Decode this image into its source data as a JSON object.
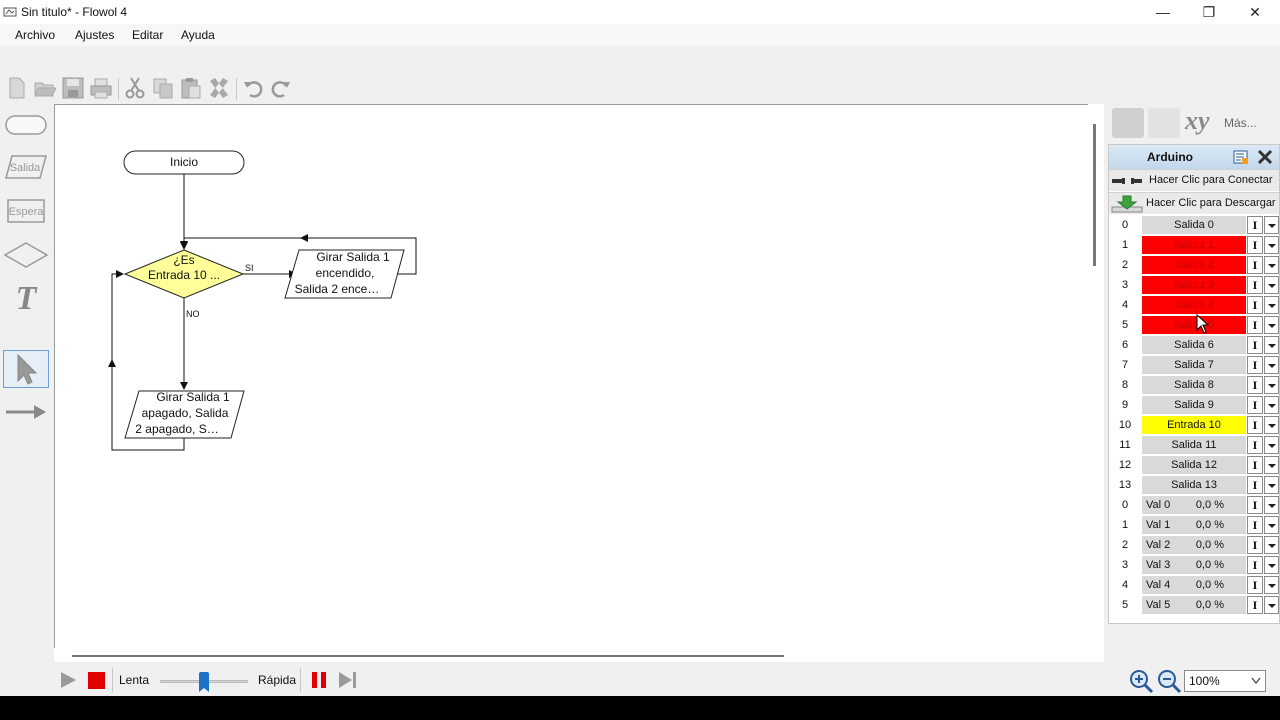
{
  "window": {
    "title": "Sin titulo* - Flowol 4",
    "minimize_glyph": "—",
    "maximize_glyph": "❐",
    "close_glyph": "✕"
  },
  "menu": {
    "items": [
      "Archivo",
      "Ajustes",
      "Editar",
      "Ayuda"
    ]
  },
  "toolbar": {
    "icons": [
      "new-icon",
      "open-icon",
      "save-icon",
      "print-icon",
      "cut-icon",
      "copy-icon",
      "paste-icon",
      "delete-icon",
      "undo-icon",
      "redo-icon"
    ]
  },
  "palette": {
    "items": [
      {
        "name": "start-stop-shape",
        "label": ""
      },
      {
        "name": "output-shape",
        "label": "Salida"
      },
      {
        "name": "wait-shape",
        "label": "Espera"
      },
      {
        "name": "decision-shape",
        "label": ""
      },
      {
        "name": "text-tool",
        "label": "T"
      },
      {
        "name": "pointer-tool",
        "label": ""
      },
      {
        "name": "arrow-tool",
        "label": ""
      }
    ]
  },
  "flowchart": {
    "start": "Inicio",
    "decision_line1": "¿Es",
    "decision_line2": "Entrada 10 ...",
    "yes_label": "SI",
    "no_label": "NO",
    "output_yes": [
      "Girar Salida 1",
      "encendido,",
      "Salida 2 ence…"
    ],
    "output_no": [
      "Girar Salida 1",
      "apagado, Salida",
      "2 apagado, S…"
    ]
  },
  "right_tools": {
    "more_label": "Más...",
    "xy_label": "xy"
  },
  "arduino": {
    "title": "Arduino",
    "connect_label": "Hacer Clic para Conectar",
    "download_label": "Hacer Clic para Descargar",
    "io_button": "I",
    "digital_rows": [
      {
        "num": "0",
        "label": "Salida 0",
        "state": "off"
      },
      {
        "num": "1",
        "label": "Salida 1",
        "state": "on"
      },
      {
        "num": "2",
        "label": "Salida 2",
        "state": "on"
      },
      {
        "num": "3",
        "label": "Salida 3",
        "state": "on"
      },
      {
        "num": "4",
        "label": "Salida 4",
        "state": "on"
      },
      {
        "num": "5",
        "label": "Salida 5",
        "state": "on"
      },
      {
        "num": "6",
        "label": "Salida 6",
        "state": "off"
      },
      {
        "num": "7",
        "label": "Salida 7",
        "state": "off"
      },
      {
        "num": "8",
        "label": "Salida 8",
        "state": "off"
      },
      {
        "num": "9",
        "label": "Salida 9",
        "state": "off"
      },
      {
        "num": "10",
        "label": "Entrada 10",
        "state": "input"
      },
      {
        "num": "11",
        "label": "Salida 11",
        "state": "off"
      },
      {
        "num": "12",
        "label": "Salida 12",
        "state": "off"
      },
      {
        "num": "13",
        "label": "Salida 13",
        "state": "off"
      }
    ],
    "analog_rows": [
      {
        "num": "0",
        "label": "Val 0",
        "value": "0,0 %"
      },
      {
        "num": "1",
        "label": "Val 1",
        "value": "0,0 %"
      },
      {
        "num": "2",
        "label": "Val 2",
        "value": "0,0 %"
      },
      {
        "num": "3",
        "label": "Val 3",
        "value": "0,0 %"
      },
      {
        "num": "4",
        "label": "Val 4",
        "value": "0,0 %"
      },
      {
        "num": "5",
        "label": "Val 5",
        "value": "0,0 %"
      }
    ]
  },
  "runbar": {
    "slow_label": "Lenta",
    "fast_label": "Rápida",
    "speed_fraction": 0.5
  },
  "zoom": {
    "value": "100%"
  },
  "colors": {
    "decision_fill": "#ffff99",
    "output_on": "#ff0000",
    "input_active": "#ffff00",
    "stop_red": "#e00000"
  }
}
